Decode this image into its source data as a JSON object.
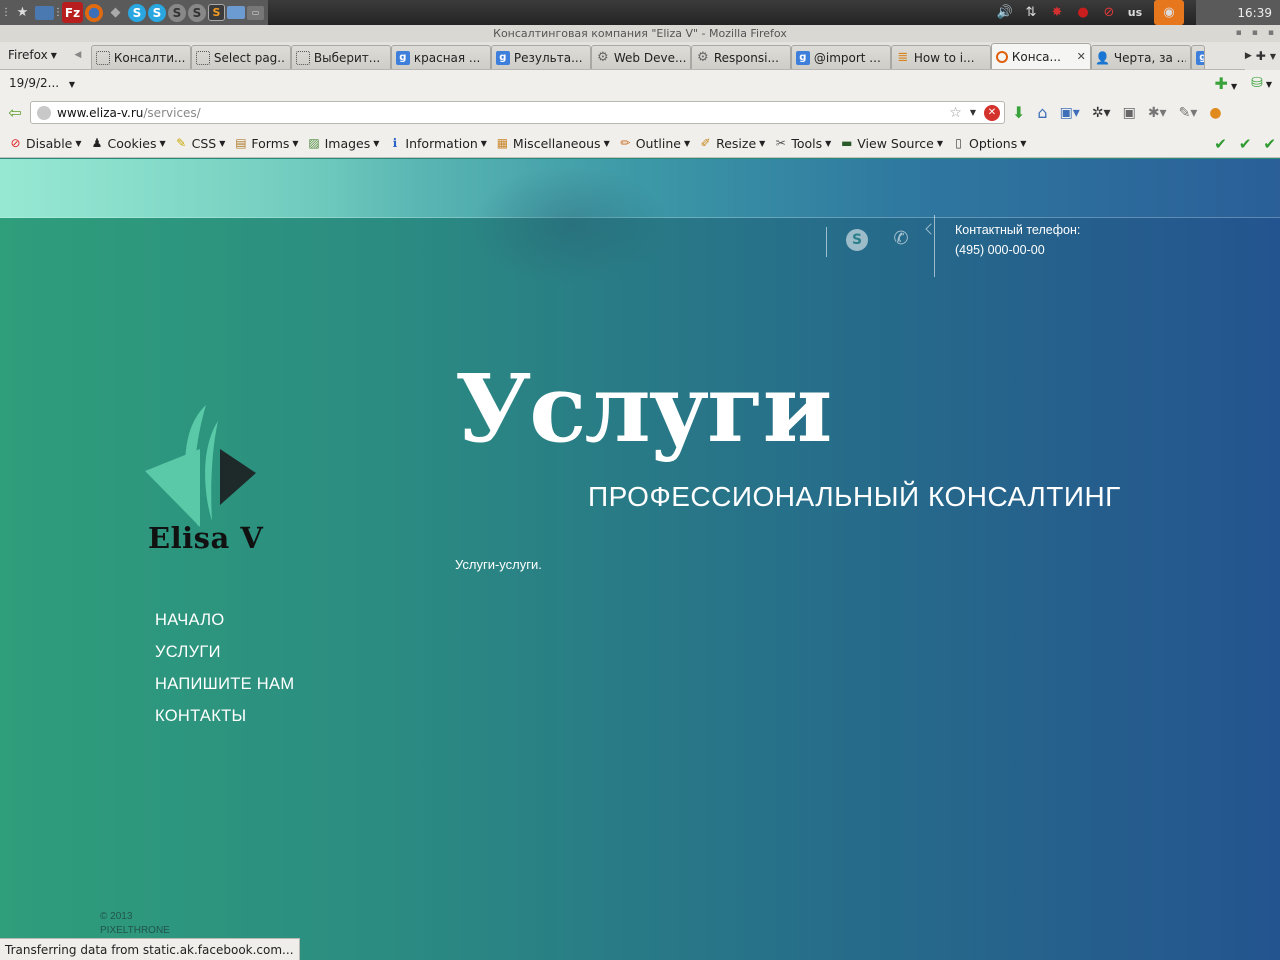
{
  "os_panel": {
    "clock": "16:39",
    "keyboard_layout": "us"
  },
  "window": {
    "title": "Консалтинговая компания \"Eliza V\" - Mozilla Firefox"
  },
  "browser": {
    "firefox_menu": "Firefox",
    "tabs": [
      {
        "label": "Консалти...",
        "favicon": "blank",
        "active": false
      },
      {
        "label": "Select pag...",
        "favicon": "blank",
        "active": false
      },
      {
        "label": "Выберит...",
        "favicon": "blank",
        "active": false
      },
      {
        "label": "красная ...",
        "favicon": "g",
        "active": false
      },
      {
        "label": "Результа...",
        "favicon": "g",
        "active": false
      },
      {
        "label": "Web Deve...",
        "favicon": "gear",
        "active": false
      },
      {
        "label": "Responsi...",
        "favicon": "gear",
        "active": false
      },
      {
        "label": "@import ...",
        "favicon": "g",
        "active": false
      },
      {
        "label": "How to i...",
        "favicon": "stackoverflow",
        "active": false
      },
      {
        "label": "Конса...",
        "favicon": "ring",
        "active": true
      },
      {
        "label": "Черта, за ...",
        "favicon": "person",
        "active": false
      }
    ],
    "history_item": "19/9/2...",
    "url_domain": "www.eliza-v.ru",
    "url_path": "/services/",
    "status_text": "Transferring data from static.ak.facebook.com..."
  },
  "webdev_toolbar": {
    "items": [
      {
        "label": "Disable",
        "icon": "disable-icon"
      },
      {
        "label": "Cookies",
        "icon": "cookies-icon"
      },
      {
        "label": "CSS",
        "icon": "css-icon"
      },
      {
        "label": "Forms",
        "icon": "forms-icon"
      },
      {
        "label": "Images",
        "icon": "images-icon"
      },
      {
        "label": "Information",
        "icon": "information-icon"
      },
      {
        "label": "Miscellaneous",
        "icon": "miscellaneous-icon"
      },
      {
        "label": "Outline",
        "icon": "outline-icon"
      },
      {
        "label": "Resize",
        "icon": "resize-icon"
      },
      {
        "label": "Tools",
        "icon": "tools-icon"
      },
      {
        "label": "View Source",
        "icon": "view-source-icon"
      },
      {
        "label": "Options",
        "icon": "options-icon"
      }
    ]
  },
  "site": {
    "contact_label": "Контактный телефон:",
    "contact_phone": "(495) 000-00-00",
    "logo_text": "Elisa V",
    "nav": [
      {
        "label": "НАЧАЛО"
      },
      {
        "label": "УСЛУГИ"
      },
      {
        "label": "НАПИШИТЕ НАМ"
      },
      {
        "label": "КОНТАКТЫ"
      }
    ],
    "title": "Услуги",
    "subtitle": "ПРОФЕССИОНАЛЬНЫЙ КОНСАЛТИНГ",
    "body": "Услуги-услуги.",
    "footer_year": "© 2013",
    "footer_name": "PIXELTHRONE"
  },
  "colors": {
    "page_left": "#2f9e7b",
    "page_right": "#24548f",
    "logo_teal": "#5ac9a8",
    "logo_dark": "#1e2a2a"
  }
}
